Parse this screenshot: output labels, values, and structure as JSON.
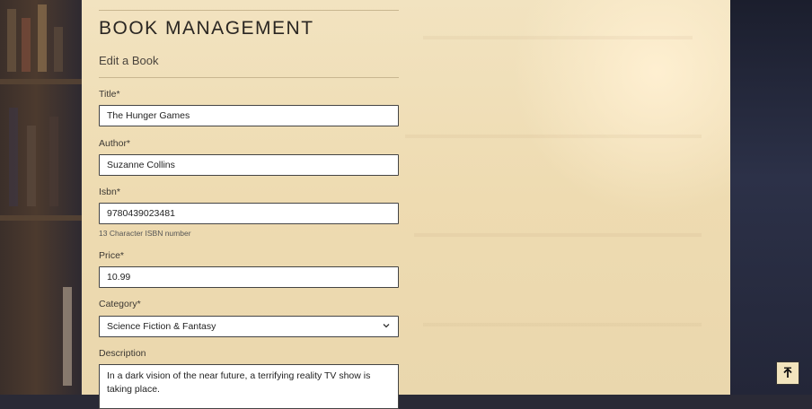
{
  "header": {
    "title": "BOOK MANAGEMENT",
    "subtitle": "Edit a Book"
  },
  "form": {
    "title_label": "Title*",
    "title_value": "The Hunger Games",
    "author_label": "Author*",
    "author_value": "Suzanne Collins",
    "isbn_label": "Isbn*",
    "isbn_value": "9780439023481",
    "isbn_help": "13 Character ISBN number",
    "price_label": "Price*",
    "price_value": "10.99",
    "category_label": "Category*",
    "category_value": "Science Fiction & Fantasy",
    "description_label": "Description",
    "description_value": "In a dark vision of the near future, a terrifying reality TV show is taking place."
  },
  "icons": {
    "select": "chevron-down-icon",
    "back_to_top": "arrow-up-icon"
  }
}
